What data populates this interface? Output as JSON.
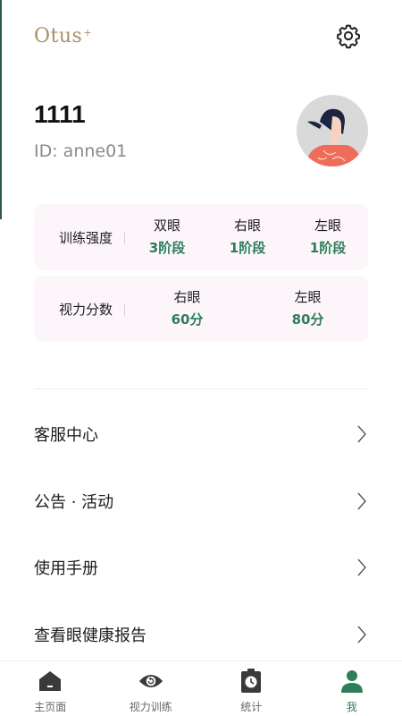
{
  "header": {
    "logo_text": "Otus",
    "logo_mark": "+",
    "settings_icon": "gear-icon"
  },
  "profile": {
    "username": "1111",
    "user_id": "ID: anne01",
    "avatar": "avatar-woman"
  },
  "training_intensity": {
    "label": "训练强度",
    "columns": [
      {
        "head": "双眼",
        "value": "3阶段"
      },
      {
        "head": "右眼",
        "value": "1阶段"
      },
      {
        "head": "左眼",
        "value": "1阶段"
      }
    ]
  },
  "vision_score": {
    "label": "视力分数",
    "columns": [
      {
        "head": "右眼",
        "value": "60分"
      },
      {
        "head": "左眼",
        "value": "80分"
      }
    ]
  },
  "menu": [
    {
      "label": "客服中心"
    },
    {
      "label": "公告 · 活动"
    },
    {
      "label": "使用手册"
    },
    {
      "label": "查看眼健康报告"
    }
  ],
  "nav": [
    {
      "label": "主页面",
      "icon": "home-icon"
    },
    {
      "label": "视力训练",
      "icon": "eye-icon"
    },
    {
      "label": "统计",
      "icon": "stats-clock-icon"
    },
    {
      "label": "我",
      "icon": "person-icon",
      "active": true
    }
  ],
  "colors": {
    "accent_green": "#2e7d5b",
    "logo_gold": "#a89066",
    "card_bg": "#fcf6fa"
  }
}
